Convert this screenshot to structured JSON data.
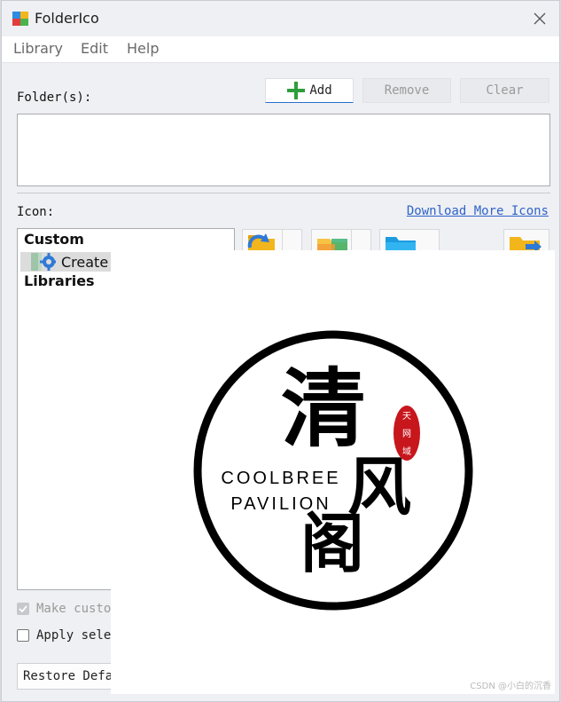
{
  "window": {
    "title": "FolderIco"
  },
  "menu": {
    "items": [
      "Library",
      "Edit",
      "Help"
    ]
  },
  "folders": {
    "label": "Folder(s):",
    "add_label": "Add",
    "remove_label": "Remove",
    "clear_label": "Clear"
  },
  "icon": {
    "label": "Icon:",
    "download_link": "Download More Icons"
  },
  "tree": {
    "custom": "Custom",
    "create_item": "Create",
    "libraries": "Libraries"
  },
  "options": {
    "make_custom_partial": "Make custon",
    "apply_selected_partial": "Apply selec",
    "restore_partial": "Restore Defa"
  },
  "logo": {
    "han_1": "清",
    "han_2": "风",
    "han_3": "阁",
    "english_1": "COOLBREE",
    "english_2": "PAVILION",
    "seal": "天网域"
  },
  "watermark": "CSDN @小白的沉香",
  "colors": {
    "accent": "#2f63c9",
    "add_green": "#2e9e3b",
    "seal_red": "#c8161d"
  }
}
